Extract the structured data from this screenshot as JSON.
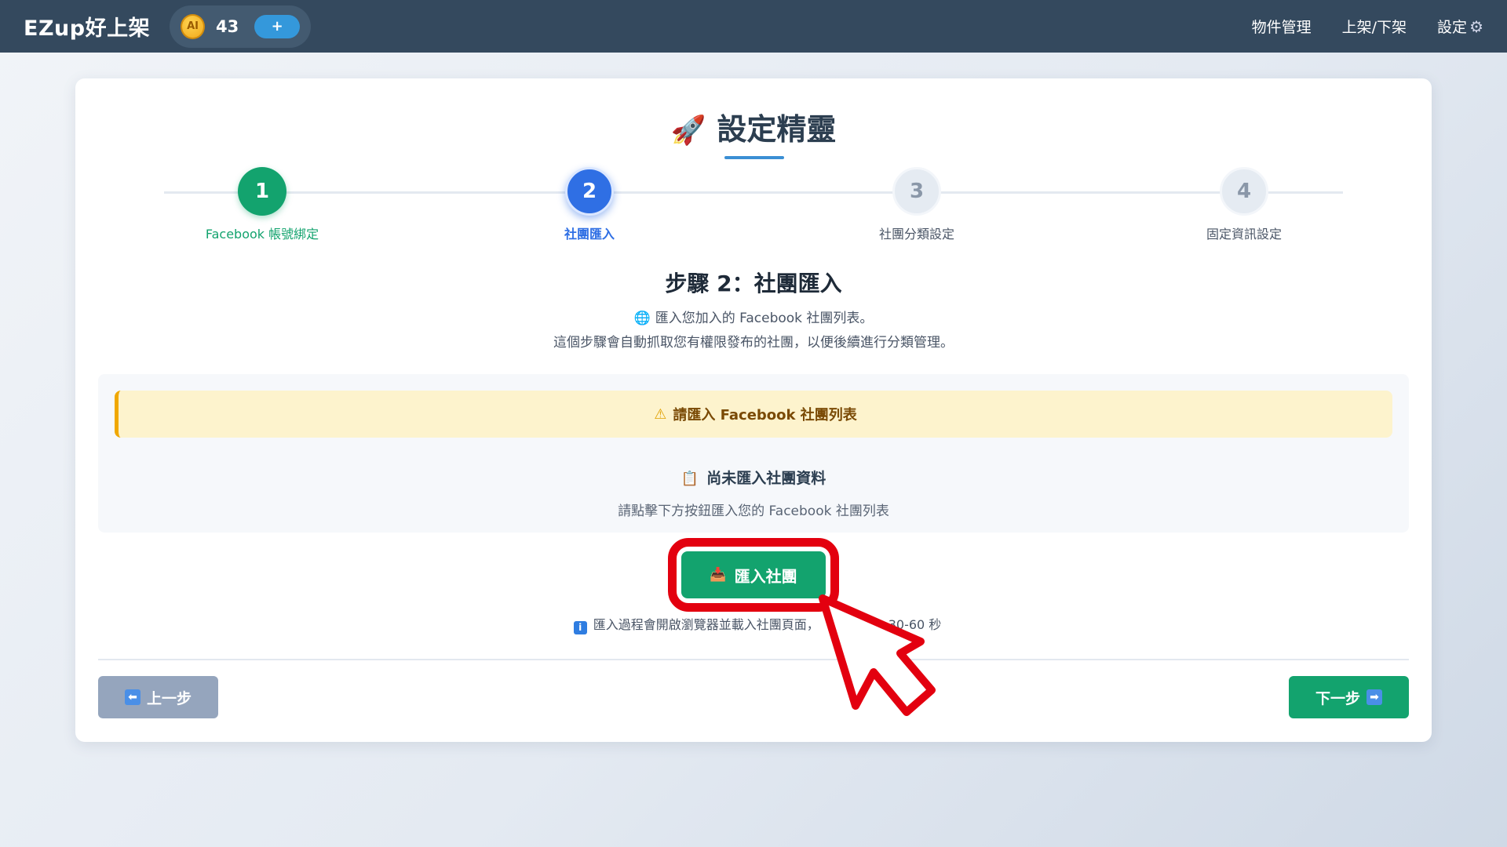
{
  "topbar": {
    "brand": "EZup好上架",
    "coin_label": "AI",
    "credits": "43",
    "add_label": "+",
    "nav": [
      {
        "label": "物件管理"
      },
      {
        "label": "上架/下架"
      },
      {
        "label": "設定"
      }
    ]
  },
  "wizard": {
    "title": "設定精靈",
    "rocket_icon": "🚀",
    "steps": [
      {
        "number": "1",
        "label": "Facebook 帳號綁定",
        "state": "done"
      },
      {
        "number": "2",
        "label": "社團匯入",
        "state": "active"
      },
      {
        "number": "3",
        "label": "社團分類設定",
        "state": "pending"
      },
      {
        "number": "4",
        "label": "固定資訊設定",
        "state": "pending"
      }
    ]
  },
  "content": {
    "heading": "步驟 2：社團匯入",
    "desc_line1": "匯入您加入的 Facebook 社團列表。",
    "desc_line2": "這個步驟會自動抓取您有權限發布的社團，以便後續進行分類管理。",
    "warning": "請匯入 Facebook 社團列表",
    "empty_title": "尚未匯入社團資料",
    "empty_sub": "請點擊下方按鈕匯入您的 Facebook 社團列表",
    "import_button": "匯入社團",
    "note_part1": "匯入過程會開啟瀏覽器並載入社團頁面，",
    "note_part2": "30-60 秒"
  },
  "footer": {
    "prev_label": "上一步",
    "next_label": "下一步"
  },
  "colors": {
    "topbar": "#34495e",
    "accent_green": "#13a36e",
    "accent_blue": "#2f6fe4",
    "warning_bg": "#fdf3cd",
    "highlight_red": "#e3000f"
  }
}
